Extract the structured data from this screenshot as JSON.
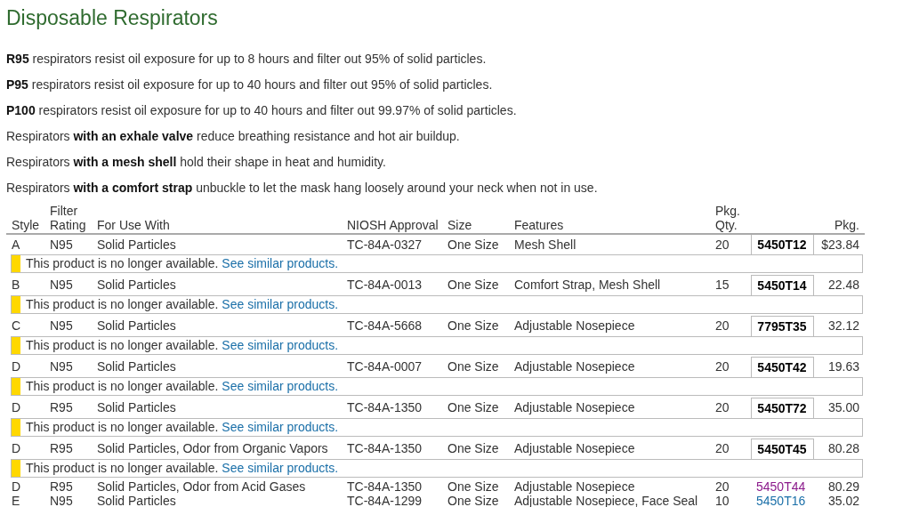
{
  "heading": "Disposable Respirators",
  "paragraphs": [
    "**R95** respirators resist oil exposure for up to 8 hours and filter out 95% of solid particles.",
    "**P95** respirators resist oil exposure for up to 40 hours and filter out 95% of solid particles.",
    "**P100** respirators resist oil exposure for up to 40 hours and filter out 99.97% of solid particles.",
    "Respirators **with an exhale valve** reduce breathing resistance and hot air buildup.",
    "Respirators **with a mesh shell** hold their shape in heat and humidity.",
    "Respirators **with a comfort strap** unbuckle to let the mask hang loosely around your neck when not in use."
  ],
  "table": {
    "columns": [
      [
        "Style"
      ],
      [
        "Filter",
        "Rating"
      ],
      [
        "For Use With"
      ],
      [
        "NIOSH Approval"
      ],
      [
        "Size"
      ],
      [
        "Features"
      ],
      [
        "Pkg.",
        "Qty."
      ],
      [],
      [
        "Pkg."
      ]
    ],
    "rows": [
      {
        "style": "A",
        "rating": "N95",
        "use": "Solid Particles",
        "niosh": "TC-84A-0327",
        "size": "One Size",
        "features": "Mesh Shell",
        "qty": "20",
        "part": "5450T12",
        "selected": true,
        "price": "$23.84",
        "discontinued": true,
        "notice": {
          "text": "This product is no longer available.",
          "link": "See similar products."
        }
      },
      {
        "style": "B",
        "rating": "N95",
        "use": "Solid Particles",
        "niosh": "TC-84A-0013",
        "size": "One Size",
        "features": "Comfort Strap, Mesh Shell",
        "qty": "15",
        "part": "5450T14",
        "selected": true,
        "price": "22.48",
        "discontinued": true,
        "notice": {
          "text": "This product is no longer available.",
          "link": "See similar products."
        }
      },
      {
        "style": "C",
        "rating": "N95",
        "use": "Solid Particles",
        "niosh": "TC-84A-5668",
        "size": "One Size",
        "features": "Adjustable Nosepiece",
        "qty": "20",
        "part": "7795T35",
        "selected": true,
        "price": "32.12",
        "discontinued": true,
        "notice": {
          "text": "This product is no longer available.",
          "link": "See similar products."
        }
      },
      {
        "style": "D",
        "rating": "N95",
        "use": "Solid Particles",
        "niosh": "TC-84A-0007",
        "size": "One Size",
        "features": "Adjustable Nosepiece",
        "qty": "20",
        "part": "5450T42",
        "selected": true,
        "price": "19.63",
        "discontinued": true,
        "notice": {
          "text": "This product is no longer available.",
          "link": "See similar products."
        }
      },
      {
        "style": "D",
        "rating": "R95",
        "use": "Solid Particles",
        "niosh": "TC-84A-1350",
        "size": "One Size",
        "features": "Adjustable Nosepiece",
        "qty": "20",
        "part": "5450T72",
        "selected": true,
        "price": "35.00",
        "discontinued": true,
        "notice": {
          "text": "This product is no longer available.",
          "link": "See similar products."
        }
      },
      {
        "style": "D",
        "rating": "R95",
        "use": "Solid Particles, Odor from Organic Vapors",
        "niosh": "TC-84A-1350",
        "size": "One Size",
        "features": "Adjustable Nosepiece",
        "qty": "20",
        "part": "5450T45",
        "selected": true,
        "price": "80.28",
        "discontinued": true,
        "notice": {
          "text": "This product is no longer available.",
          "link": "See similar products."
        }
      },
      {
        "style": "D",
        "rating": "R95",
        "use": "Solid Particles, Odor from Acid Gases",
        "niosh": "TC-84A-1350",
        "size": "One Size",
        "features": "Adjustable Nosepiece",
        "qty": "20",
        "part": "5450T44",
        "selected": false,
        "visited": true,
        "price": "80.29",
        "discontinued": false
      },
      {
        "style": "E",
        "rating": "N95",
        "use": "Solid Particles",
        "niosh": "TC-84A-1299",
        "size": "One Size",
        "features": "Adjustable Nosepiece, Face Seal",
        "qty": "10",
        "part": "5450T16",
        "selected": false,
        "visited": false,
        "price": "35.02",
        "discontinued": false
      }
    ]
  }
}
